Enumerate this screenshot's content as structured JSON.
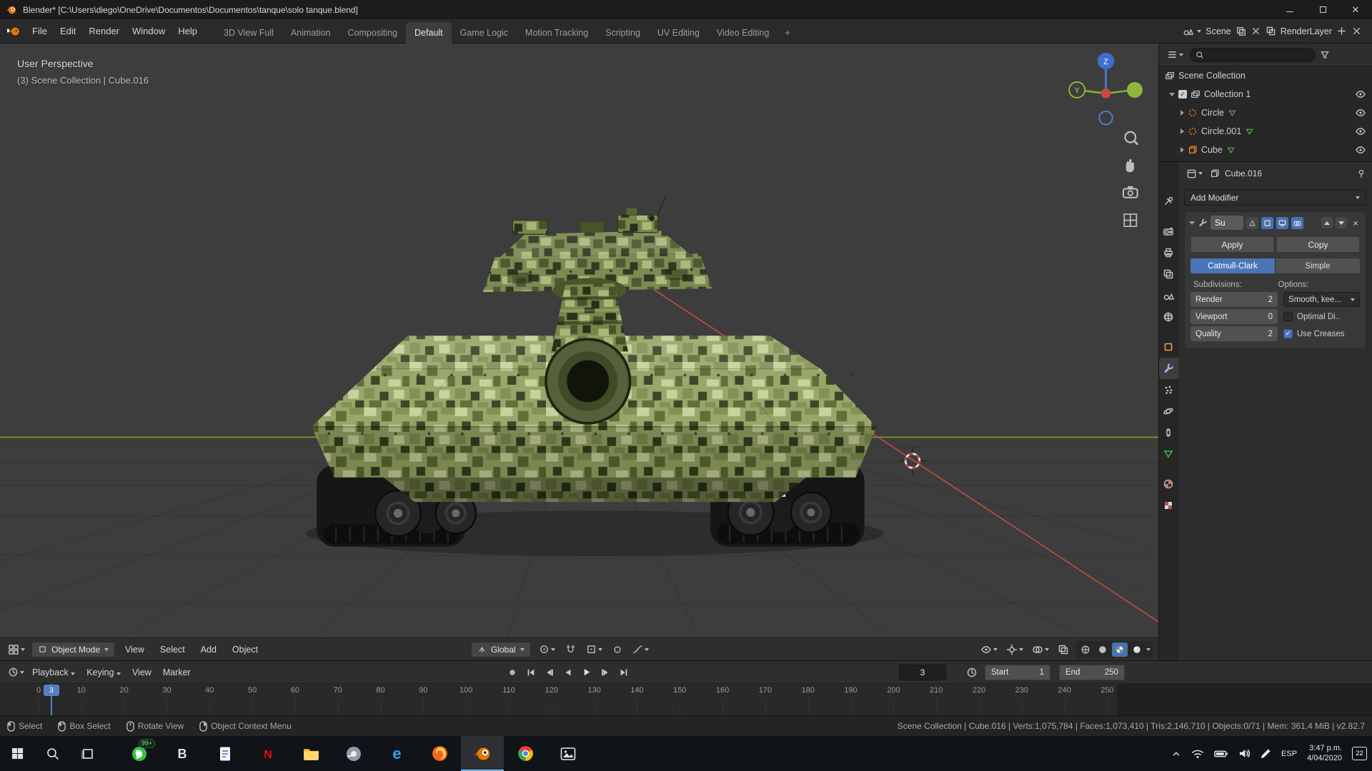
{
  "colors": {
    "accent_blue": "#4772b3",
    "object_orange": "#e8862d",
    "data_green": "#3fae4a",
    "axis_red": "#cc4b42",
    "axis_green": "#7ba22a",
    "axis_blue": "#3f6ecf"
  },
  "title_bar": {
    "title": "Blender* [C:\\Users\\diego\\OneDrive\\Documentos\\Documentos\\tanque\\solo tanque.blend]"
  },
  "top_bar": {
    "menus": [
      "File",
      "Edit",
      "Render",
      "Window",
      "Help"
    ],
    "workspaces": [
      "3D View Full",
      "Animation",
      "Compositing",
      "Default",
      "Game Logic",
      "Motion Tracking",
      "Scripting",
      "UV Editing",
      "Video Editing"
    ],
    "active_workspace": "Default",
    "add_workspace": "+",
    "scene_name": "Scene",
    "render_layer_name": "RenderLayer"
  },
  "viewport": {
    "perspective": "User Perspective",
    "context": "(3) Scene Collection | Cube.016",
    "axis_labels": {
      "z": "Z",
      "y": "Y"
    }
  },
  "viewport_header": {
    "mode": "Object Mode",
    "menu_view": "View",
    "menu_select": "Select",
    "menu_add": "Add",
    "menu_object": "Object",
    "orientation": "Global"
  },
  "outliner": {
    "scene_collection": "Scene Collection",
    "collection": "Collection 1",
    "objects": [
      "Circle",
      "Circle.001",
      "Cube"
    ]
  },
  "properties": {
    "breadcrumb_object": "Cube.016",
    "add_modifier": "Add Modifier",
    "modifier_name": "Su",
    "apply": "Apply",
    "copy": "Copy",
    "catmull_clark": "Catmull-Clark",
    "simple": "Simple",
    "subdivisions_label": "Subdivisions:",
    "options_label": "Options:",
    "render_label": "Render",
    "render_value": "2",
    "viewport_label": "Viewport",
    "viewport_value": "0",
    "quality_label": "Quality",
    "quality_value": "2",
    "uv_smooth": "Smooth, kee...",
    "optimal_display": "Optimal Di..",
    "use_creases": "Use Creases"
  },
  "timeline": {
    "menu_playback": "Playback",
    "menu_keying": "Keying",
    "menu_view": "View",
    "menu_marker": "Marker",
    "current_frame": "3",
    "start_label": "Start",
    "start_value": "1",
    "end_label": "End",
    "end_value": "250",
    "ticks": [
      0,
      10,
      20,
      30,
      40,
      50,
      60,
      70,
      80,
      90,
      100,
      110,
      120,
      130,
      140,
      150,
      160,
      170,
      180,
      190,
      200,
      210,
      220,
      230,
      240,
      250
    ]
  },
  "status_bar": {
    "items": [
      "Select",
      "Box Select",
      "Rotate View",
      "Object Context Menu"
    ],
    "stats": "Scene Collection | Cube.016 | Verts:1,075,784 | Faces:1,073,410 | Tris:2,146,710 | Objects:0/71 | Mem: 361.4 MiB | v2.82.7"
  },
  "taskbar": {
    "badge_count": "99+",
    "icon_letters": {
      "netflix": "N",
      "b_app": "B",
      "edge": "e"
    },
    "language": "ESP",
    "time": "3:47 p.m.",
    "date": "4/04/2020",
    "notification_count": "22"
  }
}
